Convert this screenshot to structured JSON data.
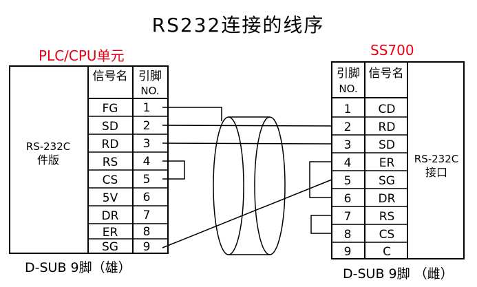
{
  "title": "RS232连接的线序",
  "left": {
    "header": "PLC/CPU单元",
    "board_label_line1": "RS-232C",
    "board_label_line2": "件版",
    "col_signal": "信号名",
    "col_pin_line1": "引脚",
    "col_pin_line2": "NO.",
    "rows": [
      {
        "signal": "FG",
        "pin": "1"
      },
      {
        "signal": "SD",
        "pin": "2"
      },
      {
        "signal": "RD",
        "pin": "3"
      },
      {
        "signal": "RS",
        "pin": "4"
      },
      {
        "signal": "CS",
        "pin": "5"
      },
      {
        "signal": "5V",
        "pin": "6"
      },
      {
        "signal": "DR",
        "pin": "7"
      },
      {
        "signal": "ER",
        "pin": "8"
      },
      {
        "signal": "SG",
        "pin": "9"
      }
    ],
    "footer": "D-SUB 9脚（雄）"
  },
  "right": {
    "header": "SS700",
    "board_label_line1": "RS-232C",
    "board_label_line2": "接口",
    "col_pin_line1": "引脚",
    "col_pin_line2": "NO.",
    "col_signal": "信号名",
    "rows": [
      {
        "pin": "1",
        "signal": "CD"
      },
      {
        "pin": "2",
        "signal": "RD"
      },
      {
        "pin": "3",
        "signal": "SD"
      },
      {
        "pin": "4",
        "signal": "ER"
      },
      {
        "pin": "5",
        "signal": "SG"
      },
      {
        "pin": "6",
        "signal": "DR"
      },
      {
        "pin": "7",
        "signal": "RS"
      },
      {
        "pin": "8",
        "signal": "CS"
      },
      {
        "pin": "9",
        "signal": "C"
      }
    ],
    "footer": "D-SUB 9脚 （雌）"
  },
  "colors": {
    "header_red": "#e60012",
    "line": "#000000",
    "background": "#ffffff"
  }
}
